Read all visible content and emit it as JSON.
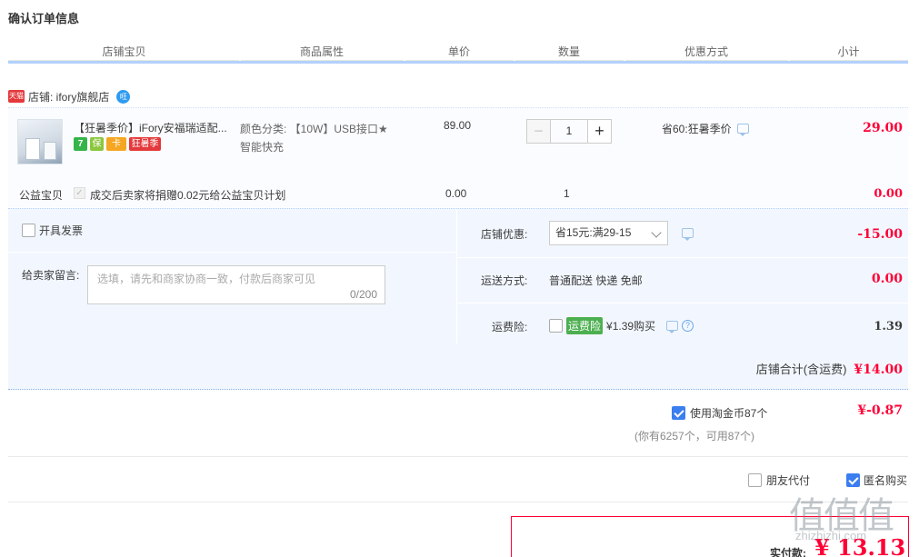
{
  "page": {
    "title": "确认订单信息"
  },
  "table_header": {
    "columns": [
      "店铺宝贝",
      "商品属性",
      "单价",
      "数量",
      "优惠方式",
      "小计"
    ]
  },
  "shop": {
    "badge": "天猫",
    "name": "店铺: ifory旗舰店",
    "ww_icon_text": "旺"
  },
  "item": {
    "title": "【狂暑季价】iFory安福瑞适配...",
    "tags": [
      "7",
      "保",
      "卡",
      "狂暑季"
    ],
    "attr_line1": "颜色分类: 【10W】USB接口★",
    "attr_line2": "智能快充",
    "price": "89.00",
    "qty": "1",
    "qty_minus": "−",
    "qty_plus": "+",
    "discount": "省60:狂暑季价",
    "subtotal": "29.00"
  },
  "charity": {
    "label": "公益宝贝",
    "check_mark": "✓",
    "text": "成交后卖家将捐赠0.02元给公益宝贝计划",
    "price": "0.00",
    "qty": "1",
    "subtotal": "0.00"
  },
  "options": {
    "invoice_label": "开具发票",
    "message_label": "给卖家留言:",
    "message_placeholder": "选填，请先和商家协商一致，付款后商家可见",
    "message_count": "0/200",
    "shop_discount_label": "店铺优惠:",
    "shop_discount_value": "省15元:满29-15",
    "shop_discount_amount": "-15.00",
    "shipping_label": "运送方式:",
    "shipping_value": "普通配送 快递 免邮",
    "shipping_amount": "0.00",
    "insurance_label": "运费险:",
    "insurance_badge": "运费险",
    "insurance_text": "¥1.39购买",
    "insurance_q": "?",
    "insurance_amount": "1.39"
  },
  "shop_total": {
    "label": "店铺合计(含运费)",
    "amount": "¥14.00"
  },
  "coins": {
    "label": "使用淘金币87个",
    "sub": "(你有6257个，可用87个)",
    "amount": "¥-0.87",
    "checked": true
  },
  "extra": {
    "friend_pay": "朋友代付",
    "anonymous": "匿名购买"
  },
  "pay": {
    "label": "实付款:",
    "amount": "¥ 13.13"
  },
  "watermark": {
    "big": "值值值",
    "small": "zhizhizhi.com"
  }
}
